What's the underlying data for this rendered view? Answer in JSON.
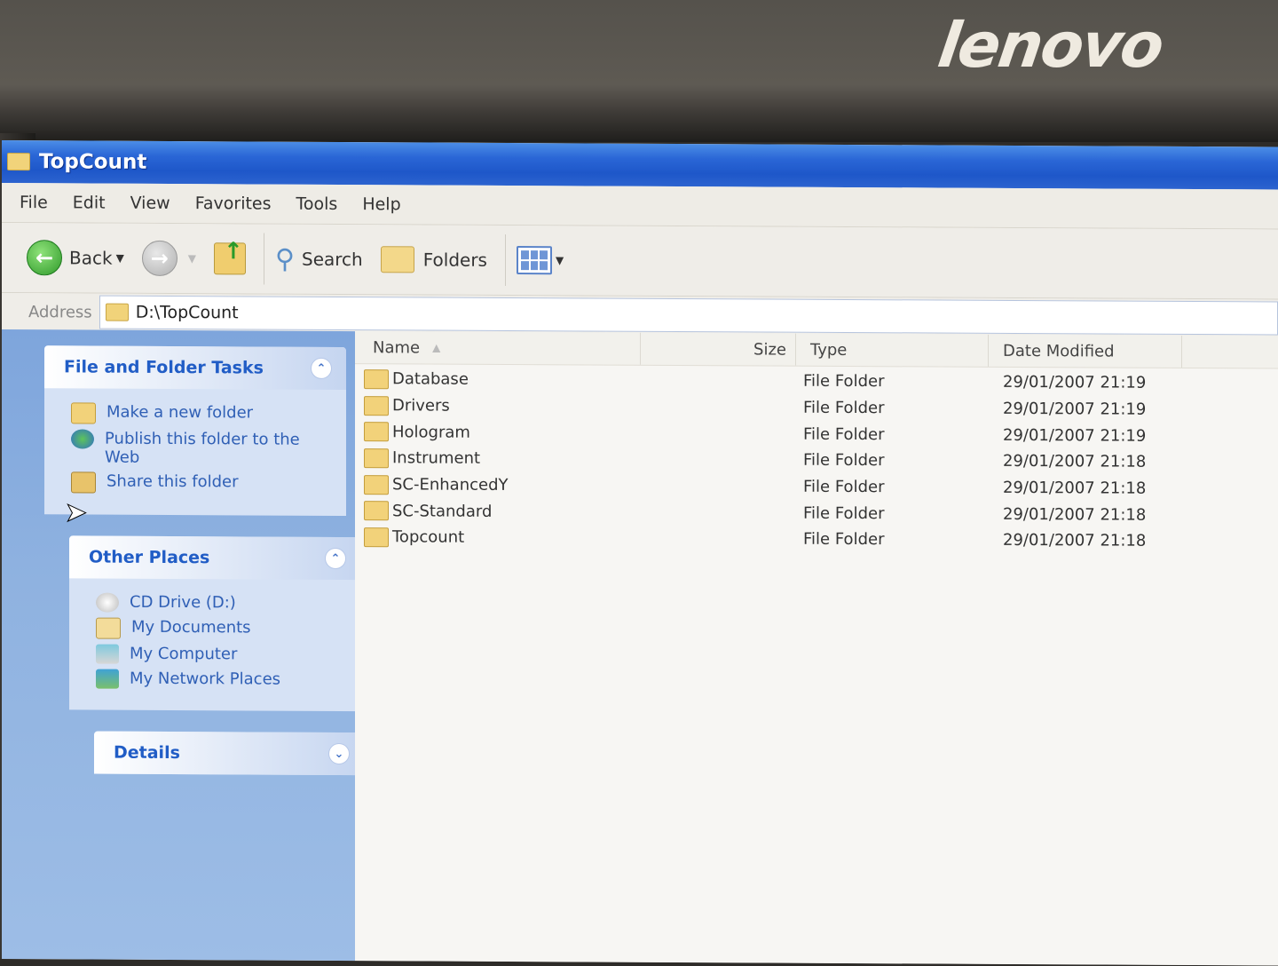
{
  "bezel": {
    "brand": "lenovo"
  },
  "window": {
    "title": "TopCount"
  },
  "menu": [
    "File",
    "Edit",
    "View",
    "Favorites",
    "Tools",
    "Help"
  ],
  "toolbar": {
    "back": "Back",
    "search": "Search",
    "folders": "Folders"
  },
  "address": {
    "label": "Address",
    "value": "D:\\TopCount"
  },
  "tasks": {
    "file_tasks": {
      "title": "File and Folder Tasks",
      "items": [
        "Make a new folder",
        "Publish this folder to the Web",
        "Share this folder"
      ]
    },
    "other_places": {
      "title": "Other Places",
      "items": [
        "CD Drive (D:)",
        "My Documents",
        "My Computer",
        "My Network Places"
      ]
    },
    "details": {
      "title": "Details"
    }
  },
  "columns": {
    "name": "Name",
    "size": "Size",
    "type": "Type",
    "date": "Date Modified"
  },
  "files": [
    {
      "name": "Database",
      "type": "File Folder",
      "date": "29/01/2007 21:19"
    },
    {
      "name": "Drivers",
      "type": "File Folder",
      "date": "29/01/2007 21:19"
    },
    {
      "name": "Hologram",
      "type": "File Folder",
      "date": "29/01/2007 21:19"
    },
    {
      "name": "Instrument",
      "type": "File Folder",
      "date": "29/01/2007 21:18"
    },
    {
      "name": "SC-EnhancedY",
      "type": "File Folder",
      "date": "29/01/2007 21:18"
    },
    {
      "name": "SC-Standard",
      "type": "File Folder",
      "date": "29/01/2007 21:18"
    },
    {
      "name": "Topcount",
      "type": "File Folder",
      "date": "29/01/2007 21:18"
    }
  ]
}
